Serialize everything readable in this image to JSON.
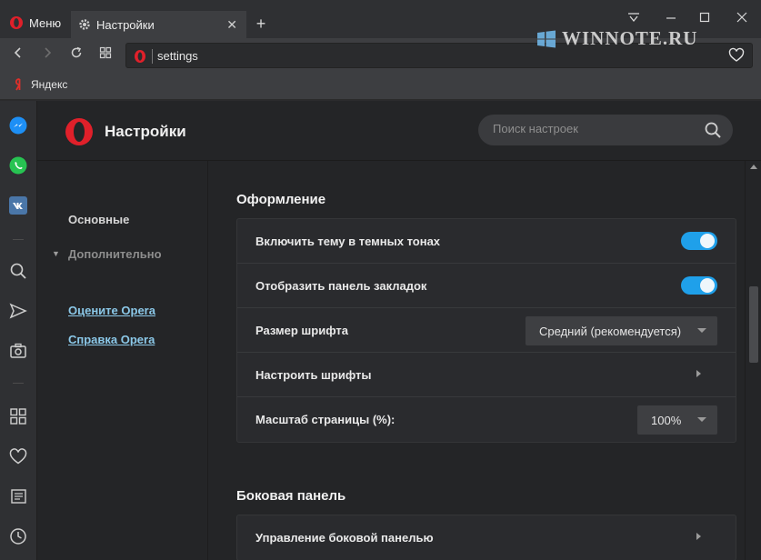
{
  "titlebar": {
    "menu_label": "Меню",
    "tab_title": "Настройки",
    "watermark": "WINNOTE.RU"
  },
  "addressbar": {
    "url": "settings"
  },
  "bookmarks": {
    "items": [
      {
        "label": "Яндекс"
      }
    ]
  },
  "sidepanel": {
    "icons": [
      "messenger-icon",
      "whatsapp-icon",
      "vk-icon",
      "search-icon",
      "send-icon",
      "camera-icon",
      "speed-dial-icon",
      "heart-icon",
      "news-icon",
      "history-icon"
    ]
  },
  "header": {
    "title": "Настройки",
    "search_placeholder": "Поиск настроек"
  },
  "nav": {
    "basic": "Основные",
    "advanced": "Дополнительно",
    "links": [
      "Оцените Opera",
      "Справка Opera"
    ]
  },
  "appearance": {
    "title": "Оформление",
    "rows": [
      {
        "label": "Включить тему в темных тонах",
        "toggle": true
      },
      {
        "label": "Отобразить панель закладок",
        "toggle": true
      },
      {
        "label": "Размер шрифта",
        "select": "Средний (рекомендуется)"
      },
      {
        "label": "Настроить шрифты"
      },
      {
        "label": "Масштаб страницы (%):",
        "select": "100%"
      }
    ]
  },
  "sidebar_section": {
    "title": "Боковая панель",
    "rows": [
      {
        "label": "Управление боковой панелью"
      }
    ]
  },
  "colors": {
    "accent": "#1fa0ea",
    "opera_red": "#e0202a",
    "link": "#8bc8e8"
  }
}
